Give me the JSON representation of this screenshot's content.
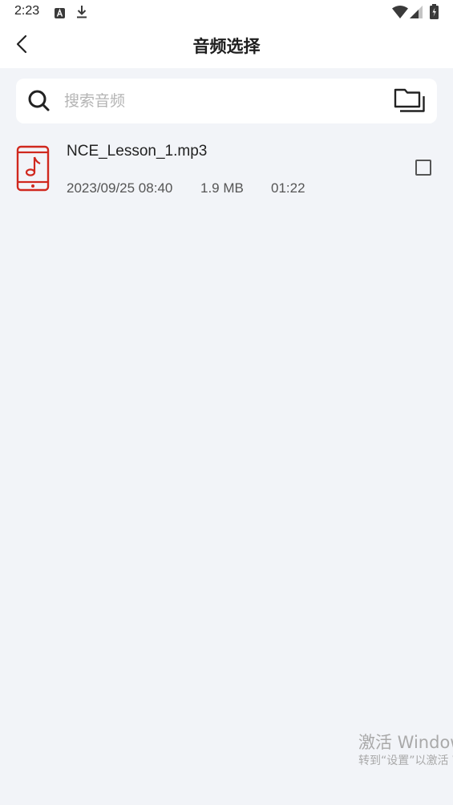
{
  "status_bar": {
    "time": "2:23",
    "icons": [
      "keyboard-a-icon",
      "download-icon",
      "wifi-icon",
      "signal-icon",
      "battery-icon"
    ]
  },
  "app_bar": {
    "title": "音频选择",
    "back_icon": "chevron-left-icon"
  },
  "search": {
    "placeholder": "搜索音频",
    "value": "",
    "icon": "search-icon",
    "folder_icon": "folder-stack-icon"
  },
  "files": [
    {
      "name": "NCE_Lesson_1.mp3",
      "date": "2023/09/25 08:40",
      "size": "1.9 MB",
      "duration": "01:22",
      "icon": "phone-music-icon",
      "checked": false
    }
  ],
  "watermark": {
    "title": "激活 Windows",
    "subtitle": "转到“设置”以激活 Windows。"
  },
  "colors": {
    "background": "#f2f4f8",
    "surface": "#ffffff",
    "accent_red": "#d0281e",
    "text_primary": "#222222",
    "text_secondary": "#555555",
    "placeholder": "#b4b4b4"
  }
}
